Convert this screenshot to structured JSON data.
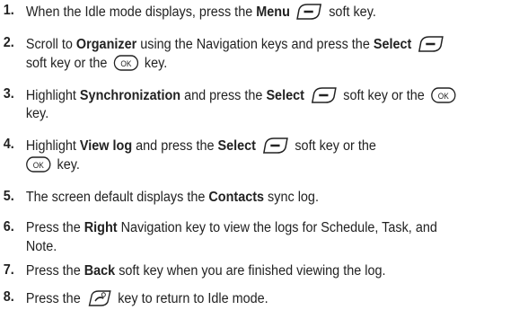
{
  "steps": [
    {
      "n": "1.",
      "t1": "When the Idle mode displays, press the ",
      "b1": "Menu",
      "t2": " soft key."
    },
    {
      "n": "2.",
      "t1": "Scroll to ",
      "b1": "Organizer",
      "t2": " using the Navigation keys and press the ",
      "b2": "Select",
      "l2a": "soft key or the ",
      "l2b": " key."
    },
    {
      "n": "3.",
      "t1": "Highlight ",
      "b1": "Synchronization",
      "t2": " and press the ",
      "b2": "Select",
      "t3": " soft key or the ",
      "l2": "key."
    },
    {
      "n": "4.",
      "t1": "Highlight ",
      "b1": "View log",
      "t2": " and press the ",
      "b2": "Select",
      "t3": " soft key or the",
      "l2": " key."
    },
    {
      "n": "5.",
      "t1": "The screen default displays the ",
      "b1": "Contacts",
      "t2": " sync log."
    },
    {
      "n": "6.",
      "t1": "Press the ",
      "b1": "Right",
      "t2": " Navigation key to view the logs for Schedule, Task, and",
      "l2": "Note."
    },
    {
      "n": "7.",
      "t1": "Press the ",
      "b1": "Back",
      "t2": " soft key when you are finished viewing the log."
    },
    {
      "n": "8.",
      "t1": "Press the ",
      "t2": " key to return to Idle mode."
    }
  ],
  "icons": {
    "soft_key": "left-soft-key-icon",
    "ok_key": "ok-key-icon",
    "end_key": "end-power-key-icon"
  },
  "ok_label": "OK",
  "colors": {
    "text": "#222222",
    "number": "#222222"
  }
}
